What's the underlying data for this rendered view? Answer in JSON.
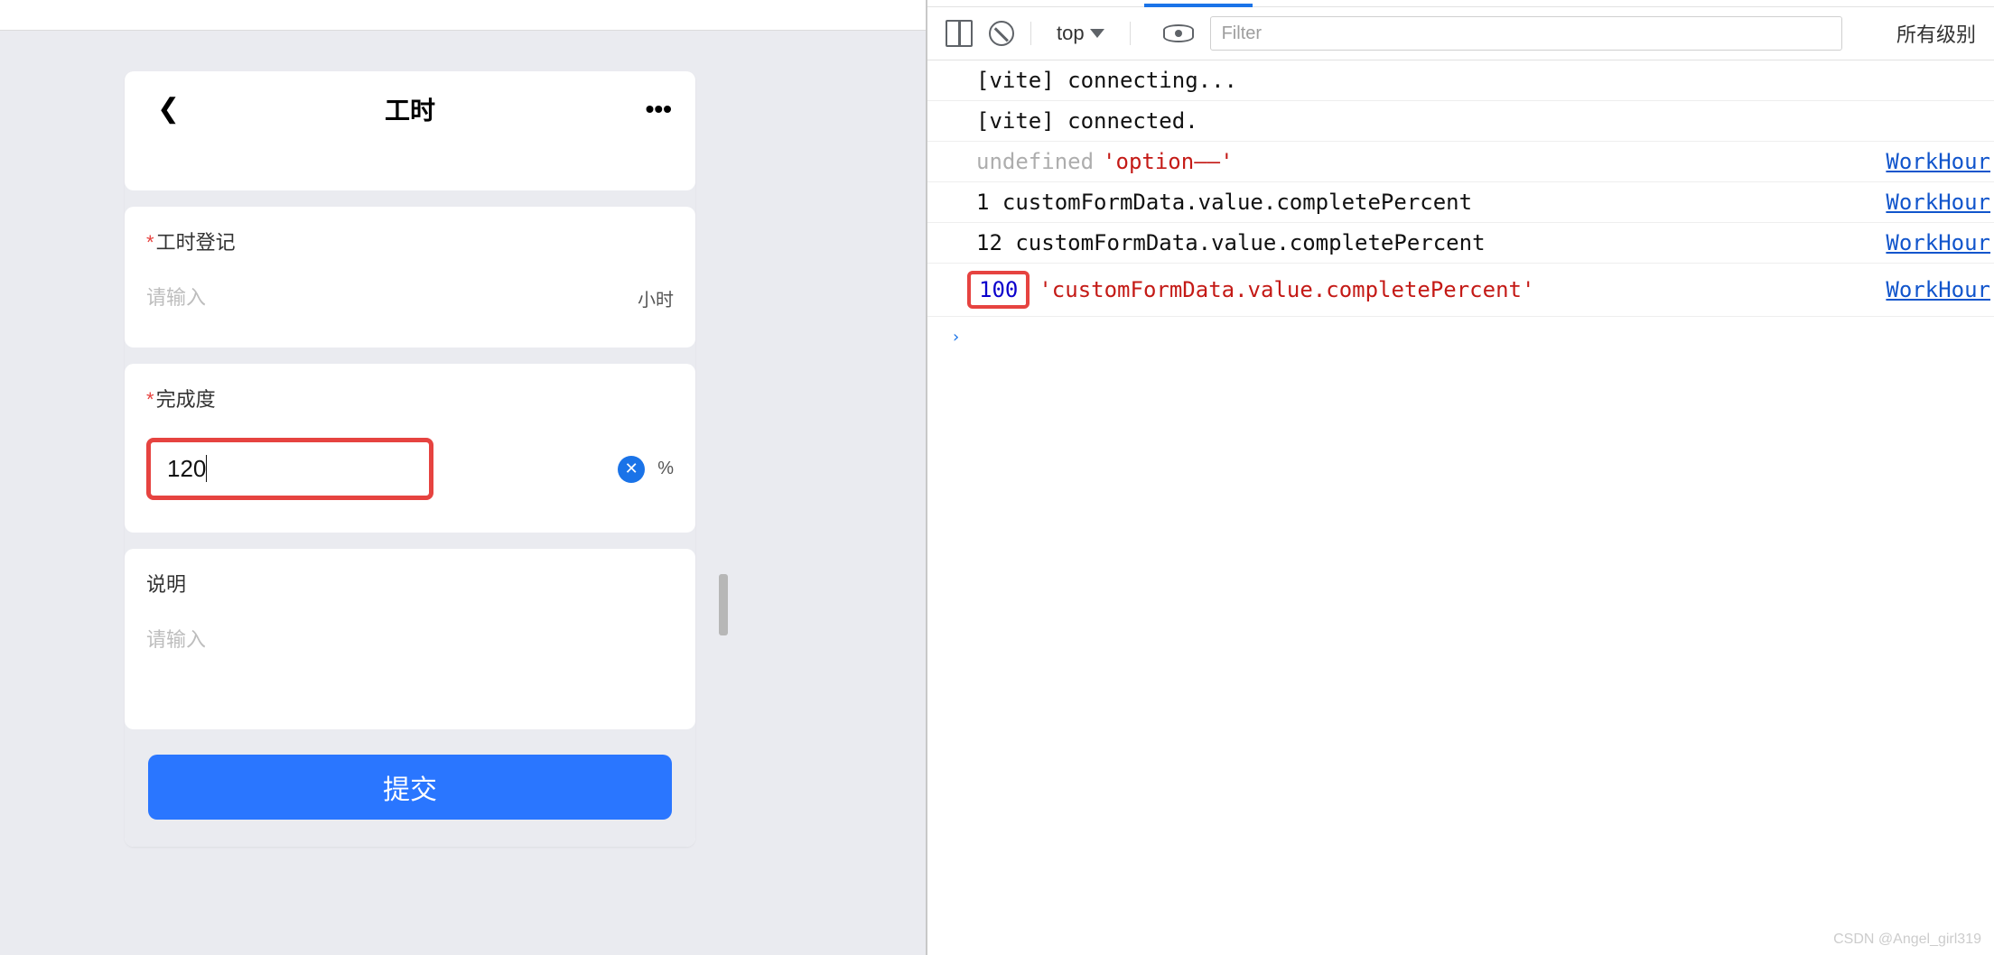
{
  "mobile": {
    "title": "工时",
    "card_hours": {
      "label": "工时登记",
      "placeholder": "请输入",
      "unit": "小时"
    },
    "card_percent": {
      "label": "完成度",
      "value": "120",
      "unit": "%"
    },
    "card_note": {
      "label": "说明",
      "placeholder": "请输入"
    },
    "submit": "提交"
  },
  "devtools": {
    "top_select": "top",
    "filter_placeholder": "Filter",
    "level_label": "所有级别",
    "logs": [
      {
        "t1": "[vite] connecting..."
      },
      {
        "t1": "[vite] connected."
      },
      {
        "dim": "undefined",
        "red": "'option——'",
        "src": "WorkHour"
      },
      {
        "t1": "1 customFormData.value.completePercent",
        "src": "WorkHour"
      },
      {
        "t1": "12 customFormData.value.completePercent",
        "src": "WorkHour"
      },
      {
        "hi": "100",
        "red": "'customFormData.value.completePercent'",
        "src": "WorkHour"
      }
    ],
    "prompt": "›"
  },
  "watermark": "CSDN @Angel_girl319"
}
